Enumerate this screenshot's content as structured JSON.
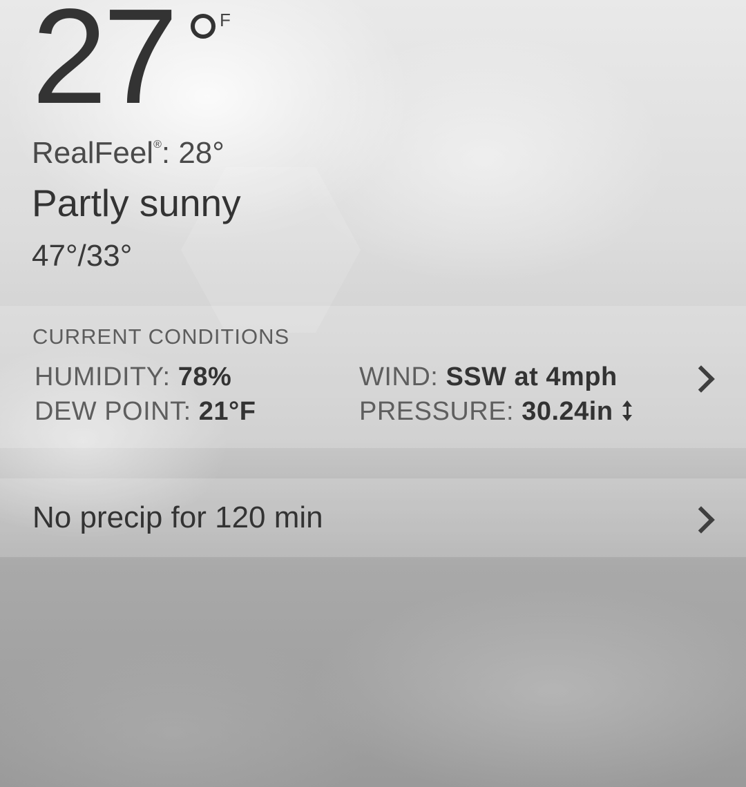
{
  "current": {
    "temperature": "27",
    "unit": "F",
    "realfeel_label": "RealFeel",
    "realfeel_mark": "®",
    "realfeel_value": ": 28°",
    "condition": "Partly sunny",
    "hilo": "47°/33°"
  },
  "conditions": {
    "title": "CURRENT CONDITIONS",
    "humidity_label": "HUMIDITY:",
    "humidity_value": "78%",
    "dewpoint_label": "DEW POINT:",
    "dewpoint_value": "21°F",
    "wind_label": "WIND:",
    "wind_value": "SSW at 4mph",
    "pressure_label": "PRESSURE:",
    "pressure_value": "30.24in",
    "pressure_trend_icon": "pressure-steady-icon"
  },
  "precip": {
    "text": "No precip for 120 min"
  },
  "icons": {
    "details_chevron": "chevron-right-icon"
  }
}
